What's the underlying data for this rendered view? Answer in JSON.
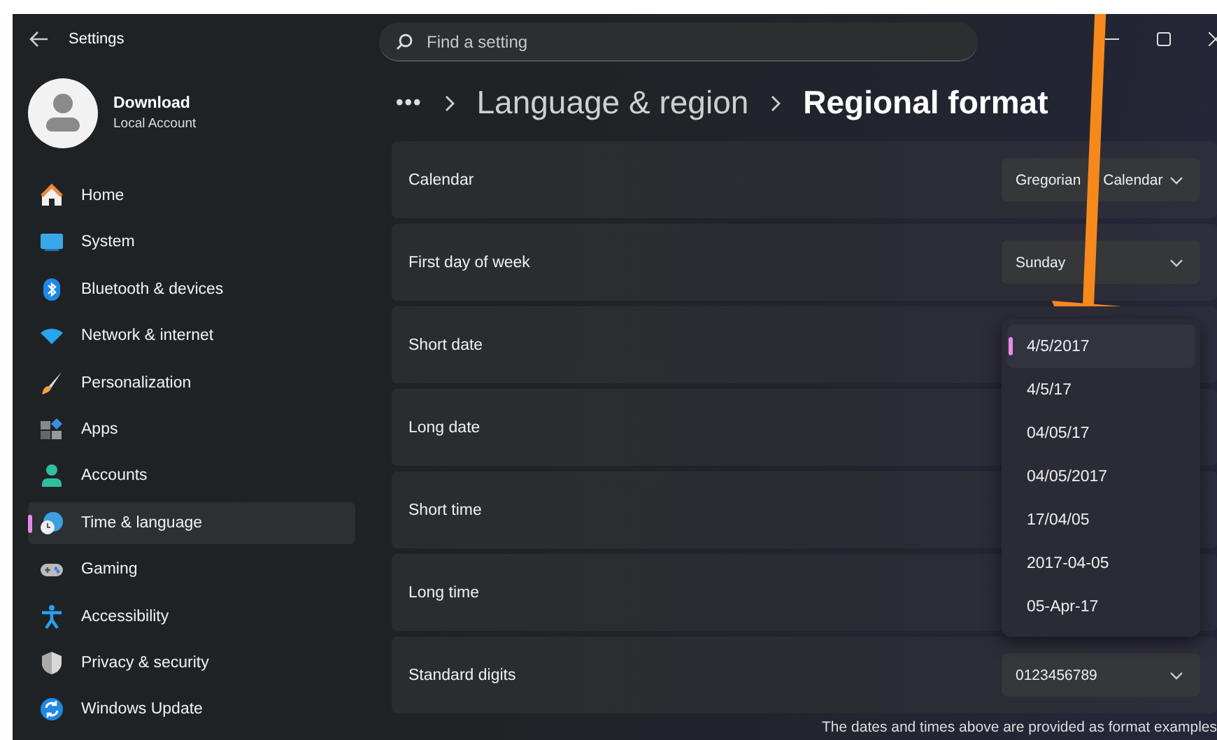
{
  "window": {
    "title": "Settings"
  },
  "search": {
    "placeholder": "Find a setting"
  },
  "account": {
    "name": "Download",
    "type": "Local Account"
  },
  "nav": {
    "items": [
      {
        "label": "Home",
        "selected": false
      },
      {
        "label": "System",
        "selected": false
      },
      {
        "label": "Bluetooth & devices",
        "selected": false
      },
      {
        "label": "Network & internet",
        "selected": false
      },
      {
        "label": "Personalization",
        "selected": false
      },
      {
        "label": "Apps",
        "selected": false
      },
      {
        "label": "Accounts",
        "selected": false
      },
      {
        "label": "Time & language",
        "selected": true
      },
      {
        "label": "Gaming",
        "selected": false
      },
      {
        "label": "Accessibility",
        "selected": false
      },
      {
        "label": "Privacy & security",
        "selected": false
      },
      {
        "label": "Windows Update",
        "selected": false
      }
    ]
  },
  "breadcrumb": {
    "more": "•••",
    "items": [
      "Language & region",
      "Regional format"
    ]
  },
  "rows": [
    {
      "kind": "dropdown",
      "label": "Calendar",
      "value": "Gregorian Calendar"
    },
    {
      "kind": "dropdown",
      "label": "First day of week",
      "value": "Sunday"
    },
    {
      "kind": "open-list",
      "label": "Short date",
      "options": [
        {
          "label": "4/5/2017",
          "selected": true
        },
        {
          "label": "4/5/17",
          "selected": false
        },
        {
          "label": "04/05/17",
          "selected": false
        },
        {
          "label": "04/05/2017",
          "selected": false
        },
        {
          "label": "17/04/05",
          "selected": false
        },
        {
          "label": "2017-04-05",
          "selected": false
        },
        {
          "label": "05-Apr-17",
          "selected": false
        }
      ]
    },
    {
      "kind": "plain",
      "label": "Long date"
    },
    {
      "kind": "plain",
      "label": "Short time"
    },
    {
      "kind": "plain",
      "label": "Long time"
    },
    {
      "kind": "dropdown",
      "label": "Standard digits",
      "value": "0123456789"
    }
  ],
  "footer_note": "The dates and times above are provided as format examples"
}
